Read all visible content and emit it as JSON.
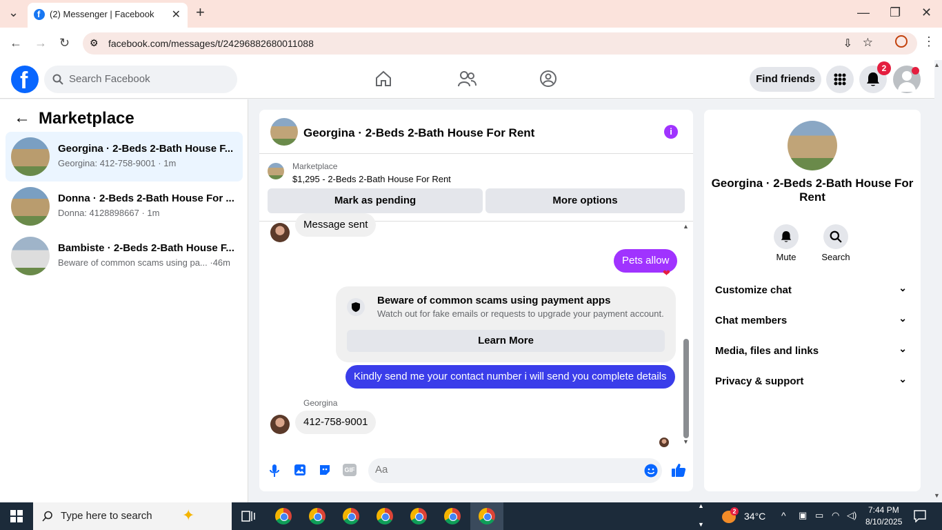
{
  "browser": {
    "tab_title": "(2) Messenger | Facebook",
    "url": "facebook.com/messages/t/24296882680011088"
  },
  "header": {
    "search_placeholder": "Search Facebook",
    "find_friends": "Find friends",
    "notification_count": "2"
  },
  "sidebar": {
    "title": "Marketplace",
    "conversations": [
      {
        "name": "Georgina · 2-Beds 2-Bath House F...",
        "sub": "Georgina: 412-758-9001 · 1m"
      },
      {
        "name": "Donna · 2-Beds 2-Bath House For ...",
        "sub": "Donna: 4128898667 · 1m"
      },
      {
        "name": "Bambiste · 2-Beds 2-Bath House F...",
        "sub": "Beware of common scams using pa...  ·46m"
      }
    ]
  },
  "chat": {
    "title": "Georgina · 2-Beds 2-Bath House For Rent",
    "marketplace_label": "Marketplace",
    "listing": "$1,295 - 2-Beds 2-Bath House For Rent",
    "mark_pending": "Mark as pending",
    "more_options": "More options",
    "messages": {
      "m1": "Message sent",
      "m2": "Pets allow",
      "m3": "Kindly send me your contact number i will send you complete details",
      "sender": "Georgina",
      "m4": "412-758-9001"
    },
    "scam_title": "Beware of common scams using payment apps",
    "scam_desc": "Watch out for fake emails or requests to upgrade your payment account.",
    "learn_more": "Learn More",
    "composer_placeholder": "Aa"
  },
  "details": {
    "name": "Georgina · 2-Beds 2-Bath House For Rent",
    "mute": "Mute",
    "search": "Search",
    "rows": [
      "Customize chat",
      "Chat members",
      "Media, files and links",
      "Privacy & support"
    ]
  },
  "taskbar": {
    "search_placeholder": "Type here to search",
    "weather": "34°C",
    "weather_badge": "2",
    "time": "7:44 PM",
    "date": "8/10/2025"
  }
}
